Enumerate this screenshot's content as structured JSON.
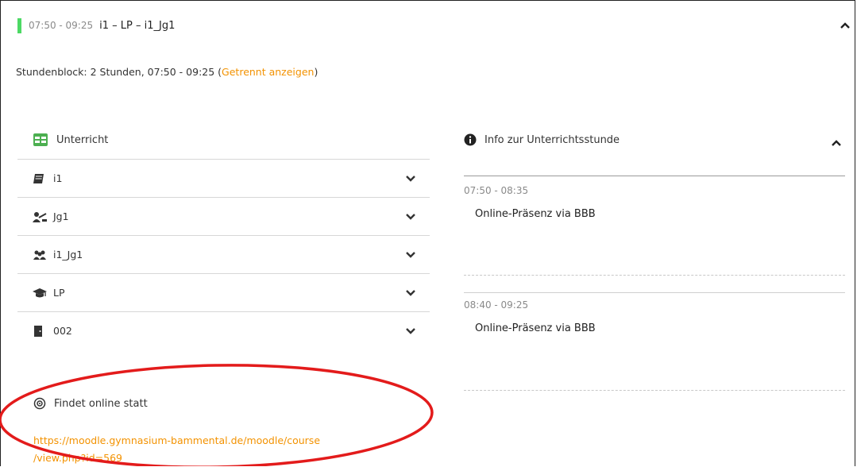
{
  "header": {
    "time": "07:50 - 09:25",
    "title": "i1 – LP – i1_Jg1",
    "accent_color": "#4cd964"
  },
  "block": {
    "text": "Stundenblock: 2 Stunden, 07:50 - 09:25 (",
    "link": "Getrennt anzeigen",
    "close": ")"
  },
  "lesson": {
    "title": "Unterricht",
    "icon": "table-icon",
    "rows": [
      {
        "icon": "book-icon",
        "label": "i1"
      },
      {
        "icon": "teacher-icon",
        "label": "Jg1"
      },
      {
        "icon": "group-icon",
        "label": "i1_Jg1"
      },
      {
        "icon": "graduation-cap-icon",
        "label": "LP"
      },
      {
        "icon": "door-icon",
        "label": "002"
      }
    ]
  },
  "online": {
    "title": "Findet online statt",
    "icon": "online-icon",
    "link_line1": "https://moodle.gymnasium-bammental.de/moodle/course",
    "link_line2": "/view.php?id=569"
  },
  "info": {
    "title": "Info zur Unterrichtsstunde",
    "slots": [
      {
        "time": "07:50 - 08:35",
        "text": "Online-Präsenz via BBB"
      },
      {
        "time": "08:40 - 09:25",
        "text": "Online-Präsenz via BBB"
      }
    ]
  },
  "colors": {
    "link": "#f39200",
    "annotation": "#e31b1b"
  }
}
